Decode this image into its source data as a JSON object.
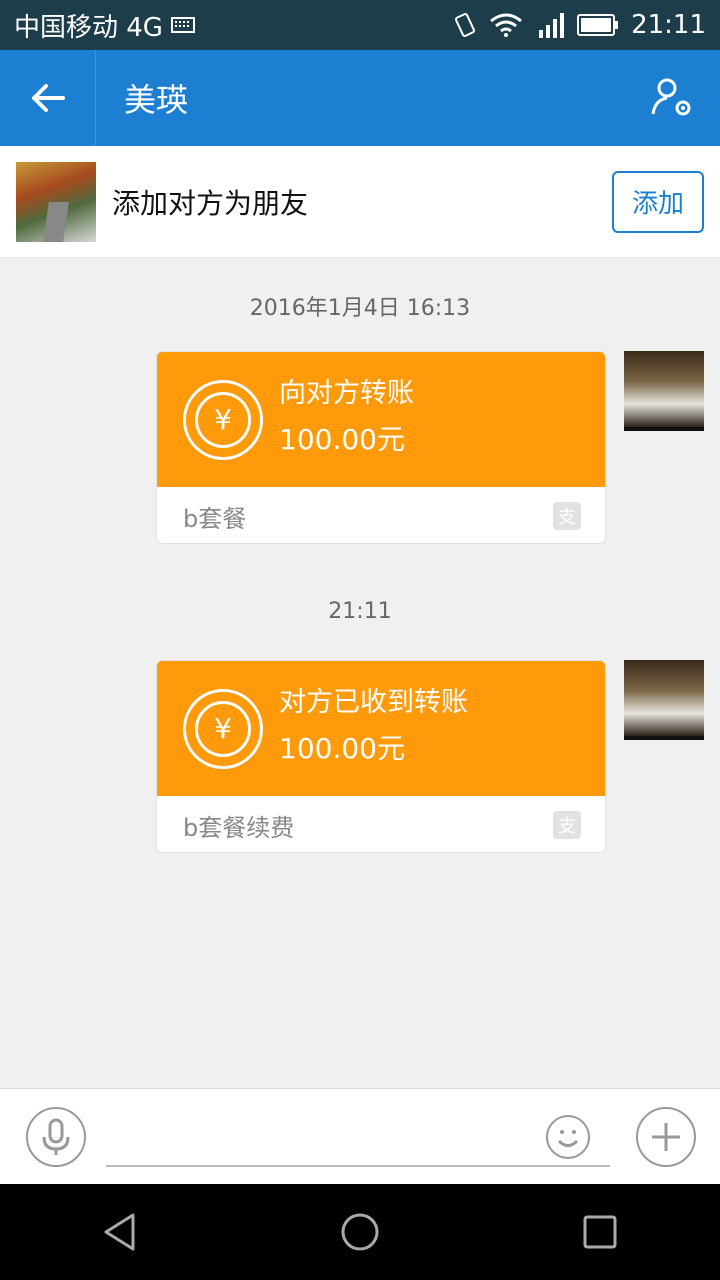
{
  "status": {
    "carrier": "中国移动 4G",
    "time": "21:11"
  },
  "header": {
    "title": "美瑛"
  },
  "friend_prompt": {
    "text": "添加对方为朋友",
    "button": "添加"
  },
  "messages": [
    {
      "timestamp": "2016年1月4日 16:13",
      "title": "向对方转账",
      "amount": "100.00元",
      "note": "b套餐"
    },
    {
      "timestamp": "21:11",
      "title": "对方已收到转账",
      "amount": "100.00元",
      "note": "b套餐续费"
    }
  ],
  "colors": {
    "appbar": "#1c7fd2",
    "transfer_card": "#ff9a0a",
    "status_bar": "#1e3d4a"
  },
  "icons": {
    "back": "arrow-left-icon",
    "profile": "person-gear-icon",
    "voice": "microphone-icon",
    "emoji": "smiley-icon",
    "more": "plus-icon"
  }
}
